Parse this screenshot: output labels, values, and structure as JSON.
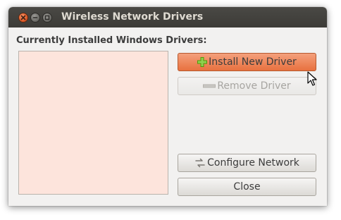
{
  "window": {
    "title": "Wireless Network Drivers"
  },
  "main": {
    "section_label": "Currently Installed Windows Drivers:",
    "drivers": []
  },
  "buttons": {
    "install": {
      "label": "Install New Driver",
      "icon": "plus-icon",
      "state": "hover"
    },
    "remove": {
      "label": "Remove Driver",
      "icon": "minus-icon",
      "state": "disabled"
    },
    "configure": {
      "label": "Configure Network",
      "icon": "network-config-icon"
    },
    "close": {
      "label": "Close"
    }
  },
  "colors": {
    "titlebar": "#3c3b37",
    "window_bg": "#f2f1f0",
    "list_bg": "#fde4dc",
    "accent_hover": "#e8713f",
    "close_button": "#e05a27"
  }
}
